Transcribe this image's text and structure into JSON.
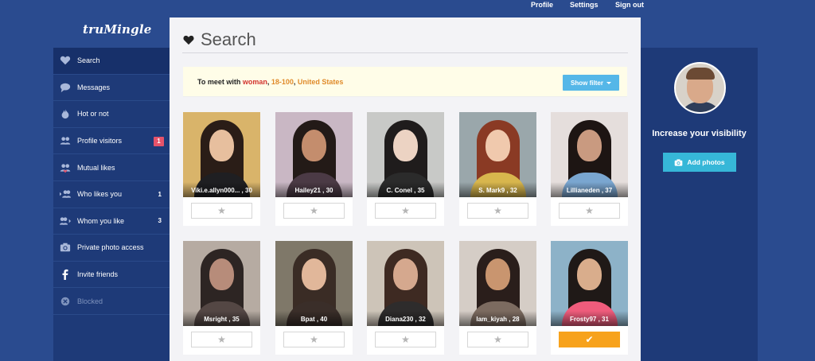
{
  "topnav": {
    "profile": "Profile",
    "settings": "Settings",
    "signout": "Sign out"
  },
  "logo": "truMingle",
  "sidebar": {
    "items": [
      {
        "label": "Search",
        "icon": "heart-icon",
        "active": true
      },
      {
        "label": "Messages",
        "icon": "chat-bubble-icon"
      },
      {
        "label": "Hot or not",
        "icon": "flame-icon"
      },
      {
        "label": "Profile visitors",
        "icon": "users-icon",
        "badge": "1"
      },
      {
        "label": "Mutual likes",
        "icon": "mutual-users-icon"
      },
      {
        "label": "Who likes you",
        "icon": "incoming-users-icon",
        "count": "1"
      },
      {
        "label": "Whom you like",
        "icon": "outgoing-users-icon",
        "count": "3"
      },
      {
        "label": "Private photo access",
        "icon": "camera-icon"
      },
      {
        "label": "Invite friends",
        "icon": "facebook-icon"
      },
      {
        "label": "Blocked",
        "icon": "blocked-icon",
        "disabled": true
      }
    ]
  },
  "main": {
    "title": "Search",
    "filter": {
      "prefix": "To meet with ",
      "gender": "woman",
      "sep": ", ",
      "age": "18-100",
      "sep2": ", ",
      "country": "United States",
      "button": "Show filter"
    }
  },
  "profiles": [
    {
      "caption": "Viki.e.allyn000... , 30",
      "favorited": false,
      "bg": "#d9b46a",
      "hair": "#2a1d17",
      "face": "#e7bf9e",
      "body": "#1f1f22"
    },
    {
      "caption": "Hailey21 , 30",
      "favorited": false,
      "bg": "#c9b7c4",
      "hair": "#231a17",
      "face": "#c48d6d",
      "body": "#4b3a45"
    },
    {
      "caption": "C. Conel , 35",
      "favorited": false,
      "bg": "#c8c9c7",
      "hair": "#1f1c1c",
      "face": "#ecd3c3",
      "body": "#2b2b2b"
    },
    {
      "caption": "S. Mark9 , 32",
      "favorited": false,
      "bg": "#9aa7ab",
      "hair": "#8a3a24",
      "face": "#f0c9ad",
      "body": "#d8b64d"
    },
    {
      "caption": "Lillianeden , 37",
      "favorited": false,
      "bg": "#e5dedc",
      "hair": "#1d1513",
      "face": "#c99a80",
      "body": "#7aa6d0"
    },
    {
      "caption": "Msright , 35",
      "favorited": false,
      "bg": "#b6aba2",
      "hair": "#2d2523",
      "face": "#b78c7a",
      "body": "#544744"
    },
    {
      "caption": "Bpat , 40",
      "favorited": false,
      "bg": "#7f7869",
      "hair": "#3a2c25",
      "face": "#e1b79a",
      "body": "#3a2e29"
    },
    {
      "caption": "Diana230 , 32",
      "favorited": false,
      "bg": "#cdc4b8",
      "hair": "#3e2a22",
      "face": "#d5a88e",
      "body": "#2e2c2c"
    },
    {
      "caption": "Iam_kiyah , 28",
      "favorited": false,
      "bg": "#d5cdc6",
      "hair": "#2a1e1b",
      "face": "#c9956f",
      "body": "#7c6b60"
    },
    {
      "caption": "Frosty97 , 31",
      "favorited": true,
      "bg": "#8db2c8",
      "hair": "#1f1917",
      "face": "#d9ad8c",
      "body": "#ef5c7c"
    }
  ],
  "rightpanel": {
    "heading": "Increase your visibility",
    "button": "Add photos"
  }
}
